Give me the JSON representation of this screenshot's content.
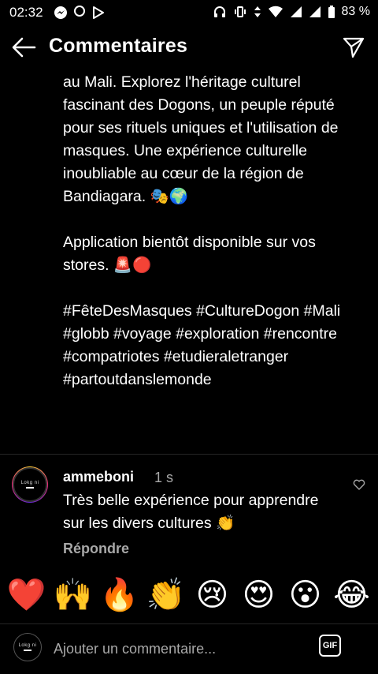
{
  "status_bar": {
    "time": "02:32",
    "battery": "83 %"
  },
  "header": {
    "title": "Commentaires"
  },
  "caption": {
    "text": "au Mali. Explorez l'héritage culturel fascinant des Dogons, un peuple réputé pour ses rituels uniques et l'utilisation de masques. Une expérience culturelle inoubliable au cœur de la région de Bandiagara. 🎭🌍\n\nApplication bientôt disponible sur vos stores. 🚨🔴\n\n#FêteDesMasques #CultureDogon #Mali #globb #voyage #exploration #rencontre #compatriotes #etudieraletranger #partoutdanslemonde"
  },
  "comment": {
    "username": "ammeboni",
    "time": "1 s",
    "text": "Très belle expérience pour apprendre sur les divers cultures 👏",
    "reply_label": "Répondre",
    "avatar_text": "Lokg ni"
  },
  "emoji_bar": [
    "❤️",
    "🙌",
    "🔥",
    "👏",
    "😢",
    "😍",
    "😮",
    "😂"
  ],
  "input": {
    "placeholder": "Ajouter un commentaire...",
    "gif_label": "GIF",
    "avatar_text": "Lokg ni"
  }
}
